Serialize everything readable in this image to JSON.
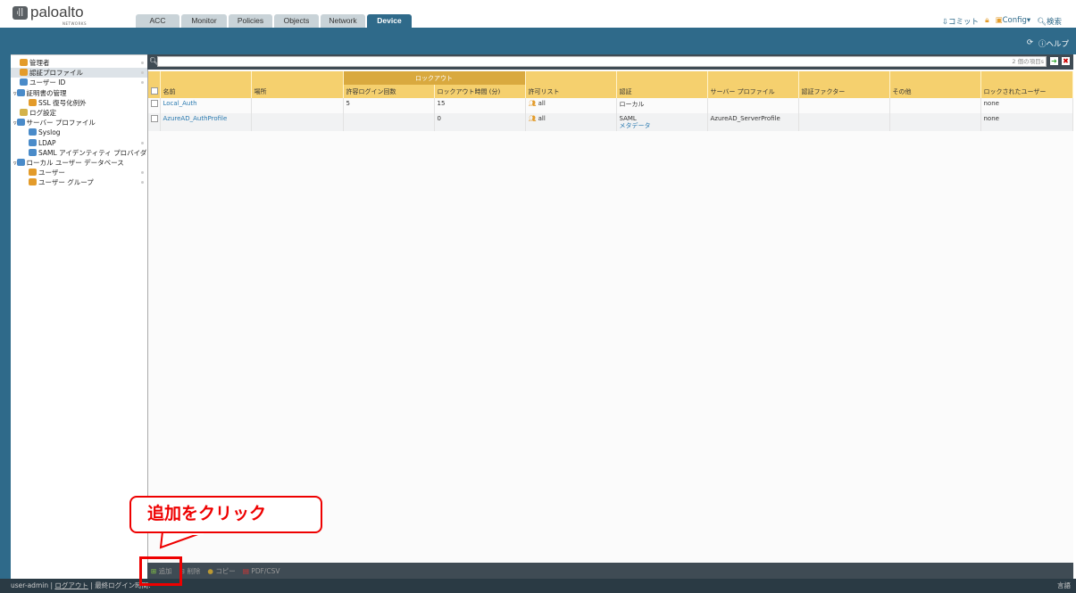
{
  "brand": {
    "name": "paloalto",
    "sub": "NETWORKS"
  },
  "tabs": [
    "ACC",
    "Monitor",
    "Policies",
    "Objects",
    "Network",
    "Device"
  ],
  "active_tab": "Device",
  "top_links": {
    "commit": "コミット",
    "config": "Config",
    "search": "検索"
  },
  "band_links": {
    "help": "ヘルプ"
  },
  "sidebar": [
    {
      "label": "管理者",
      "indent": 0,
      "color": "#e39b2a"
    },
    {
      "label": "認証プロファイル",
      "indent": 0,
      "color": "#e39b2a",
      "selected": true
    },
    {
      "label": "ユーザー ID",
      "indent": 0,
      "color": "#4a8bc9"
    },
    {
      "label": "証明書の管理",
      "indent": 0,
      "color": "#4a8bc9",
      "expand": true
    },
    {
      "label": "SSL 復号化例外",
      "indent": 1,
      "color": "#e39b2a"
    },
    {
      "label": "ログ設定",
      "indent": 0,
      "color": "#d4b24a"
    },
    {
      "label": "サーバー プロファイル",
      "indent": 0,
      "color": "#4a8bc9",
      "expand": true
    },
    {
      "label": "Syslog",
      "indent": 1,
      "color": "#4a8bc9"
    },
    {
      "label": "LDAP",
      "indent": 1,
      "color": "#4a8bc9"
    },
    {
      "label": "SAML アイデンティティ プロバイダ",
      "indent": 1,
      "color": "#4a8bc9"
    },
    {
      "label": "ローカル ユーザー データベース",
      "indent": 0,
      "color": "#4a8bc9",
      "expand": true
    },
    {
      "label": "ユーザー",
      "indent": 1,
      "color": "#e39b2a"
    },
    {
      "label": "ユーザー グループ",
      "indent": 1,
      "color": "#e39b2a"
    }
  ],
  "search": {
    "count": "2 個の項目s"
  },
  "table": {
    "group_header": "ロックアウト",
    "columns": [
      "名前",
      "場所",
      "許容ログイン回数",
      "ロックアウト時間 (分)",
      "許可リスト",
      "認証",
      "サーバー プロファイル",
      "認証ファクター",
      "その他",
      "ロックされたユーザー"
    ],
    "rows": [
      {
        "name": "Local_Auth",
        "location": "",
        "attempts": "5",
        "lockout": "15",
        "allow": "all",
        "auth": "ローカル",
        "auth_link": "",
        "server": "",
        "factor": "",
        "other": "",
        "locked": "none"
      },
      {
        "name": "AzureAD_AuthProfile",
        "location": "",
        "attempts": "",
        "lockout": "0",
        "allow": "all",
        "auth": "SAML",
        "auth_link": "メタデータ",
        "server": "AzureAD_ServerProfile",
        "factor": "",
        "other": "",
        "locked": "none"
      }
    ]
  },
  "toolbar": {
    "add": "追加",
    "delete": "削除",
    "copy": "コピー",
    "pdf": "PDF/CSV"
  },
  "footer": {
    "user": "user-admin",
    "logout": "ログアウト",
    "last_login": "最終ログイン時間:",
    "lang": "言語"
  },
  "callout": "追加をクリック"
}
